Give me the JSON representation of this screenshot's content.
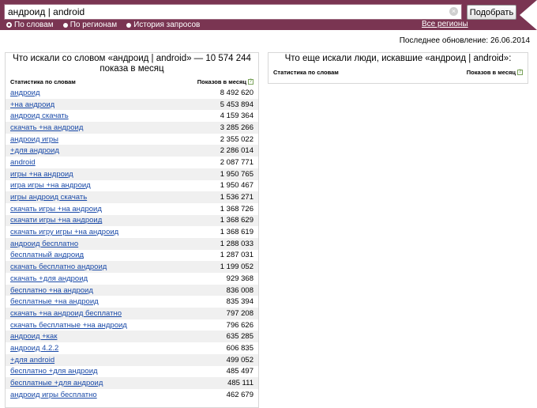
{
  "search": {
    "query": "андроид | android",
    "submit_label": "Подобрать",
    "clear_glyph": "×"
  },
  "modes": [
    {
      "label": "По словам",
      "selected": true
    },
    {
      "label": "По регионам",
      "selected": false
    },
    {
      "label": "История запросов",
      "selected": false
    }
  ],
  "regions_link": "Все регионы",
  "last_updated": "Последнее обновление: 26.06.2014",
  "left_panel": {
    "title": "Что искали со словом «андроид | android» — 10 574 244 показа в месяц",
    "col_keywords": "Статистика по словам",
    "col_impressions": "Показов в месяц",
    "rows": [
      {
        "keyword": "андроид",
        "count": "8 492 620"
      },
      {
        "keyword": "+на андроид",
        "count": "5 453 894"
      },
      {
        "keyword": "андроид скачать",
        "count": "4 159 364"
      },
      {
        "keyword": "скачать +на андроид",
        "count": "3 285 266"
      },
      {
        "keyword": "андроид игры",
        "count": "2 355 022"
      },
      {
        "keyword": "+для андроид",
        "count": "2 286 014"
      },
      {
        "keyword": "android",
        "count": "2 087 771"
      },
      {
        "keyword": "игры +на андроид",
        "count": "1 950 765"
      },
      {
        "keyword": "игра игры +на андроид",
        "count": "1 950 467"
      },
      {
        "keyword": "игры андроид скачать",
        "count": "1 536 271"
      },
      {
        "keyword": "скачать игры +на андроид",
        "count": "1 368 726"
      },
      {
        "keyword": "скачати игры +на андроид",
        "count": "1 368 629"
      },
      {
        "keyword": "скачать игру игры +на андроид",
        "count": "1 368 619"
      },
      {
        "keyword": "андроид бесплатно",
        "count": "1 288 033"
      },
      {
        "keyword": "бесплатный андроид",
        "count": "1 287 031"
      },
      {
        "keyword": "скачать бесплатно андроид",
        "count": "1 199 052"
      },
      {
        "keyword": "скачать +для андроид",
        "count": "929 368"
      },
      {
        "keyword": "бесплатно +на андроид",
        "count": "836 008"
      },
      {
        "keyword": "бесплатные +на андроид",
        "count": "835 394"
      },
      {
        "keyword": "скачать +на андроид бесплатно",
        "count": "797 208"
      },
      {
        "keyword": "скачать бесплатные +на андроид",
        "count": "796 626"
      },
      {
        "keyword": "андроид +как",
        "count": "635 285"
      },
      {
        "keyword": "андроид 4.2.2",
        "count": "606 835"
      },
      {
        "keyword": "+для android",
        "count": "499 052"
      },
      {
        "keyword": "бесплатно +для андроид",
        "count": "485 497"
      },
      {
        "keyword": "бесплатные +для андроид",
        "count": "485 111"
      },
      {
        "keyword": "андроид игры бесплатно",
        "count": "462 679"
      }
    ]
  },
  "right_panel": {
    "title": "Что еще искали люди, искавшие «андроид | android»:",
    "col_keywords": "Статистика по словам",
    "col_impressions": "Показов в месяц"
  },
  "colors": {
    "header_bg": "#7a3552",
    "link": "#1a4aa8",
    "row_alt": "#f0f0f0"
  }
}
